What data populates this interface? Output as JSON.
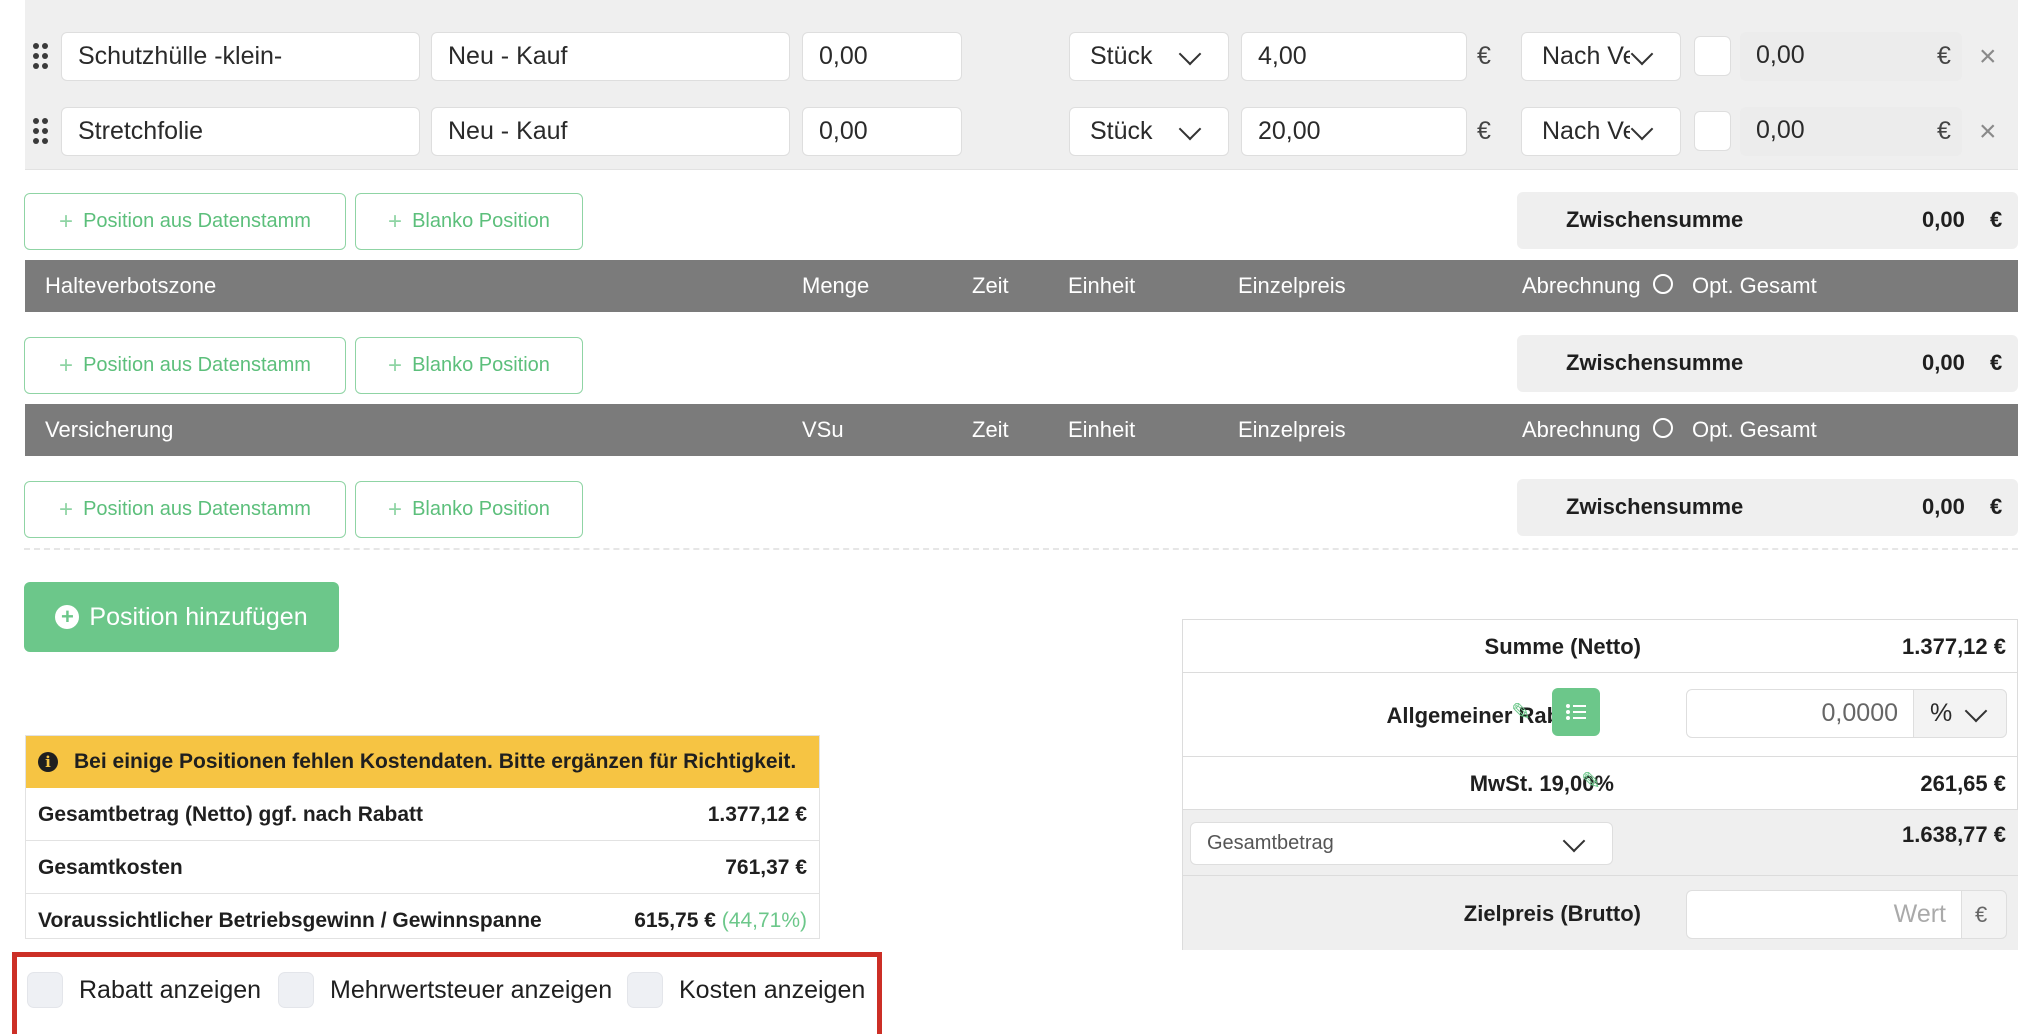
{
  "rows": [
    {
      "name": "Schutzhülle -klein-",
      "type": "Neu - Kauf",
      "menge": "0,00",
      "unit": "Stück",
      "price": "4,00",
      "currency": "€",
      "billing": "Nach Ve",
      "total": "0,00",
      "total_currency": "€",
      "remove": "×"
    },
    {
      "name": "Stretchfolie",
      "type": "Neu - Kauf",
      "menge": "0,00",
      "unit": "Stück",
      "price": "20,00",
      "currency": "€",
      "billing": "Nach Ve",
      "total": "0,00",
      "total_currency": "€",
      "remove": "×"
    }
  ],
  "buttons": {
    "from_master": "Position aus Datenstamm",
    "blank": "Blanko Position",
    "add_position": "Position hinzufügen",
    "plus": "+"
  },
  "subtotal": {
    "label": "Zwischensumme",
    "value": "0,00",
    "currency": "€"
  },
  "sections": [
    {
      "title": "Halteverbotszone",
      "col_qty": "Menge",
      "col_time": "Zeit",
      "col_unit": "Einheit",
      "col_price": "Einzelpreis",
      "col_billing": "Abrechnung",
      "col_total": "Opt. Gesamt"
    },
    {
      "title": "Versicherung",
      "col_qty": "VSu",
      "col_time": "Zeit",
      "col_unit": "Einheit",
      "col_price": "Einzelpreis",
      "col_billing": "Abrechnung",
      "col_total": "Opt. Gesamt"
    }
  ],
  "summary": {
    "netto_label": "Summe (Netto)",
    "netto_value": "1.377,12 €",
    "discount_label": "Allgemeiner Rabatt",
    "discount_value": "0,0000",
    "discount_unit": "%",
    "vat_label": "MwSt. 19,00%",
    "vat_value": "261,65 €",
    "total_select": "Gesamtbetrag",
    "total_value": "1.638,77 €",
    "target_label": "Zielpreis (Brutto)",
    "target_placeholder": "Wert",
    "target_currency": "€"
  },
  "costs": {
    "warning": "Bei einige Positionen fehlen Kostendaten. Bitte ergänzen für Richtigkeit.",
    "rows": [
      {
        "label": "Gesamtbetrag (Netto) ggf. nach Rabatt",
        "value": "1.377,12 €",
        "extra": ""
      },
      {
        "label": "Gesamtkosten",
        "value": "761,37 €",
        "extra": ""
      },
      {
        "label": "Voraussichtlicher Betriebsgewinn / Gewinnspanne",
        "value": "615,75 €",
        "extra": "(44,71%)"
      }
    ]
  },
  "toggles": [
    {
      "label": "Rabatt anzeigen"
    },
    {
      "label": "Mehrwertsteuer anzeigen"
    },
    {
      "label": "Kosten anzeigen"
    }
  ],
  "colors": {
    "accent_green": "#6cc78a",
    "header_gray": "#7b7b7b",
    "warning_yellow": "#f6c443",
    "highlight_red": "#cc2f26"
  }
}
